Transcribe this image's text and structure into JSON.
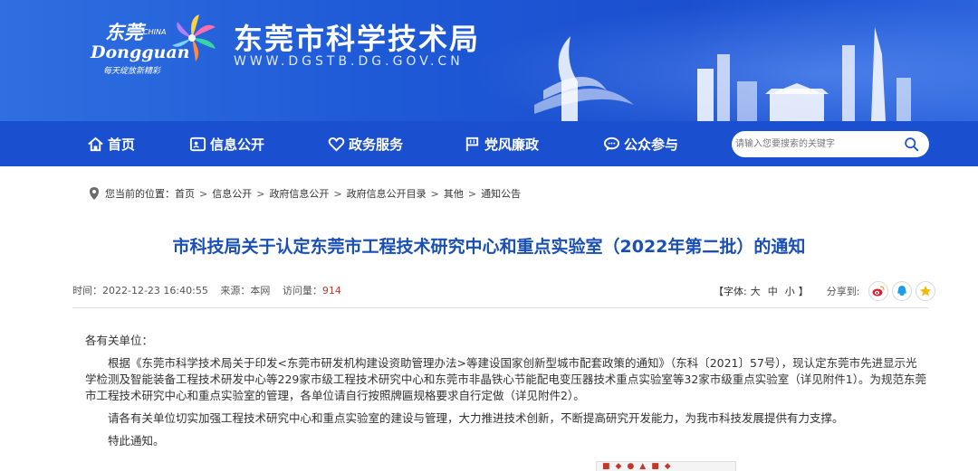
{
  "header": {
    "logo_cn": "东莞",
    "logo_china": "CHINA",
    "logo_en": "Dongguan",
    "logo_slogan": "每天绽放新精彩",
    "site_title": "东莞市科学技术局",
    "site_url": "WWW.DGSTB.DG.GOV.CN"
  },
  "nav": {
    "items": [
      {
        "label": "首页",
        "icon": "home-icon"
      },
      {
        "label": "信息公开",
        "icon": "id-card-icon"
      },
      {
        "label": "政务服务",
        "icon": "heart-icon"
      },
      {
        "label": "党风廉政",
        "icon": "flag-icon"
      },
      {
        "label": "公众参与",
        "icon": "chat-icon"
      }
    ],
    "search_placeholder": "请输入您要搜索的关键字"
  },
  "breadcrumb": {
    "prefix": "您当前的位置：",
    "items": [
      "首页",
      "信息公开",
      "政府信息公开",
      "政府信息公开目录",
      "其他",
      "通知公告"
    ]
  },
  "article": {
    "title": "市科技局关于认定东莞市工程技术研究中心和重点实验室（2022年第二批）的通知",
    "time_label": "时间：",
    "time": "2022-12-23 16:40:55",
    "source_label": "来源：",
    "source": "本网",
    "views_label": "访问量：",
    "views": "914",
    "font_label_open": "【字体:",
    "font_large": "大",
    "font_medium": "中",
    "font_small": "小",
    "font_label_close": "】",
    "share_label": "分享到:",
    "greeting": "各有关单位：",
    "para1": "根据《东莞市科学技术局关于印发<东莞市研发机构建设资助管理办法>等建设国家创新型城市配套政策的通知》（东科〔2021〕57号），现认定东莞市先进显示光学检测及智能装备工程技术研发中心等229家市级工程技术研究中心和东莞市非晶铁心节能配电变压器技术重点实验室等32家市级重点实验室（详见附件1）。为规范东莞市工程技术研究中心和重点实验室的管理，各单位请自行按照牌匾规格要求自行定做（详见附件2）。",
    "para2": "请各有关单位切实加强工程技术研究中心和重点实验室的建设与管理，大力推进技术创新，不断提高研究开发能力，为我市科技发展提供有力支撑。",
    "closing": "特此通知。"
  },
  "colors": {
    "nav_bg": "#1a4fd0",
    "title_color": "#1a4fb6",
    "views_color": "#c0392b"
  }
}
